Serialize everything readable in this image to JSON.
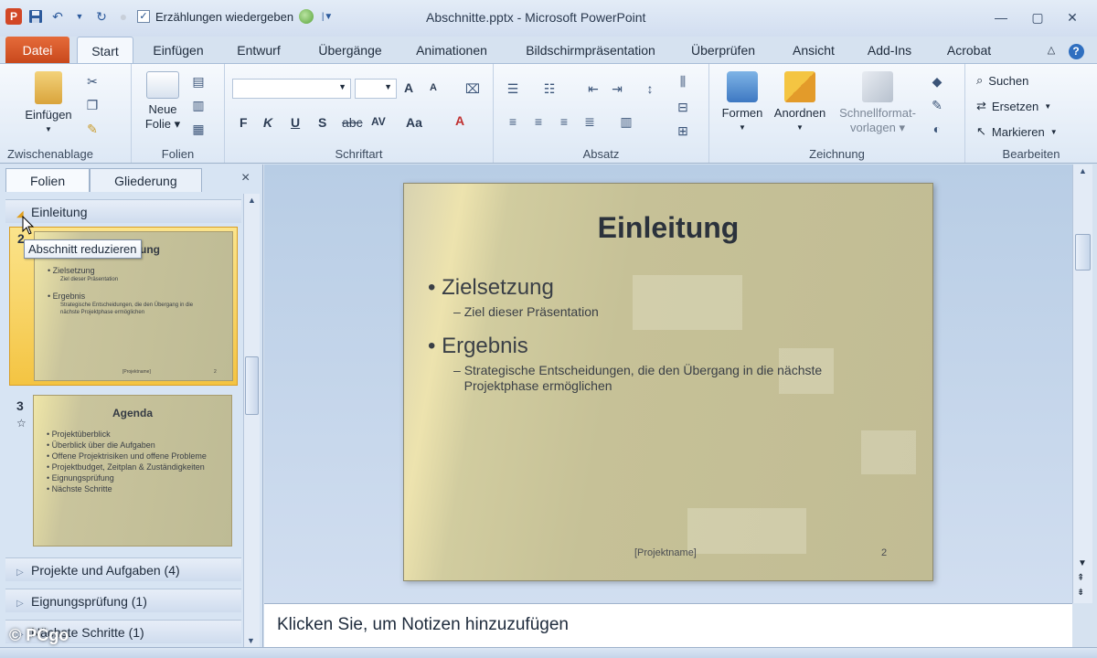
{
  "window": {
    "title": "Abschnitte.pptx - Microsoft PowerPoint",
    "qat_checkbox_label": "Erzählungen wiedergeben",
    "app_logo": "P"
  },
  "tabs": [
    "Datei",
    "Start",
    "Einfügen",
    "Entwurf",
    "Übergänge",
    "Animationen",
    "Bildschirmpräsentation",
    "Überprüfen",
    "Ansicht",
    "Add-Ins",
    "Acrobat"
  ],
  "ribbon": {
    "clipboard": {
      "paste": "Einfügen",
      "group": "Zwischenablage"
    },
    "slides": {
      "new_slide_line1": "Neue",
      "new_slide_line2": "Folie",
      "group": "Folien"
    },
    "font": {
      "group": "Schriftart",
      "bold": "F",
      "italic": "K",
      "underline": "U",
      "shadow": "S",
      "strike": "abc",
      "spacing": "AV",
      "case": "Aa",
      "color": "A",
      "grow": "A",
      "shrink": "A"
    },
    "paragraph": {
      "group": "Absatz"
    },
    "drawing": {
      "shapes": "Formen",
      "arrange": "Anordnen",
      "quickstyles_line1": "Schnellformat-",
      "quickstyles_line2": "vorlagen",
      "group": "Zeichnung"
    },
    "editing": {
      "find": "Suchen",
      "replace": "Ersetzen",
      "select": "Markieren",
      "group": "Bearbeiten"
    }
  },
  "left_pane": {
    "tab_slides": "Folien",
    "tab_outline": "Gliederung",
    "close": "×",
    "section_intro": "Einleitung",
    "tooltip": "Abschnitt reduzieren",
    "slide2": {
      "number": "2",
      "title": "Einleitung",
      "b1": "Zielsetzung",
      "b1s": "Ziel dieser Präsentation",
      "b2": "Ergebnis",
      "b2s": "Strategische Entscheidungen, die den Übergang in die nächste Projektphase ermöglichen",
      "footer": "[Projektname]",
      "page": "2"
    },
    "slide3": {
      "number": "3",
      "title": "Agenda",
      "items": [
        "Projektüberblick",
        "Überblick über die Aufgaben",
        "Offene Projektrisiken und offene Probleme",
        "Projektbudget, Zeitplan & Zuständigkeiten",
        "Eignungsprüfung",
        "Nächste Schritte"
      ]
    },
    "sections": [
      "Projekte und Aufgaben (4)",
      "Eignungsprüfung (1)",
      "Nächste Schritte (1)"
    ]
  },
  "slide": {
    "title": "Einleitung",
    "bullet1": "Zielsetzung",
    "bullet1_sub": "Ziel dieser Präsentation",
    "bullet2": "Ergebnis",
    "bullet2_sub_line1": "Strategische Entscheidungen, die den Übergang in die nächste",
    "bullet2_sub_line2": "Projektphase ermöglichen",
    "footer": "[Projektname]",
    "page": "2"
  },
  "notes": {
    "placeholder": "Klicken Sie, um Notizen hinzuzufügen"
  },
  "watermark": "© PCgo",
  "colors": {
    "file_tab": "#d24726",
    "slide_bg": "#c6c197",
    "ribbon_bg": "#eef3fa"
  }
}
